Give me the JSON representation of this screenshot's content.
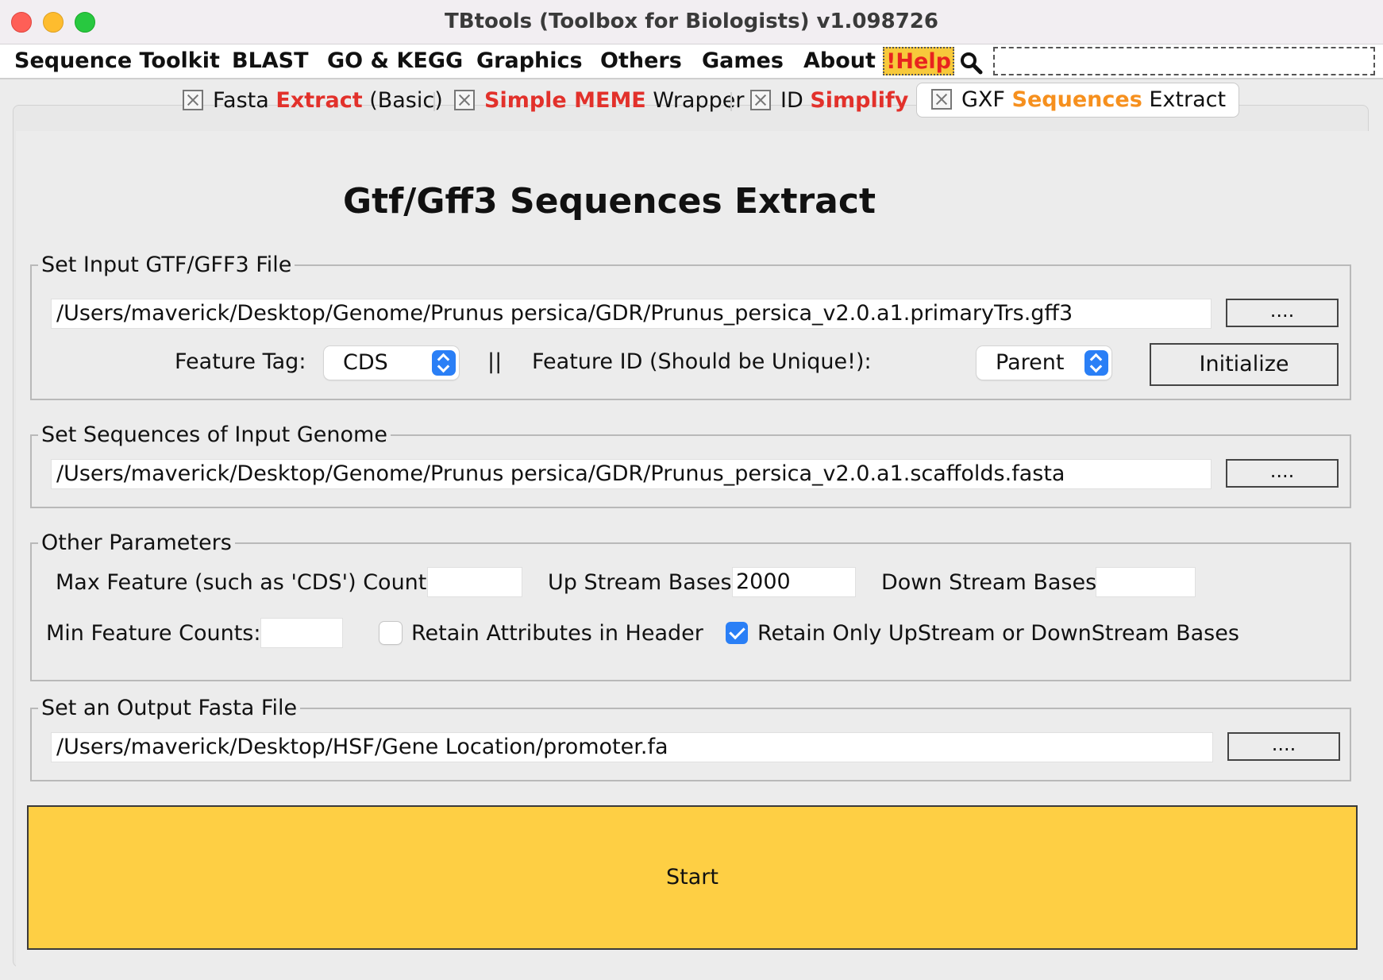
{
  "window": {
    "title": "TBtools (Toolbox for Biologists) v1.098726"
  },
  "menu": {
    "items": [
      "Sequence Toolkit",
      "BLAST",
      "GO & KEGG",
      "Graphics",
      "Others",
      "Games",
      "About"
    ],
    "help": "!Help"
  },
  "tabs": [
    {
      "parts": [
        "Fasta ",
        "Extract",
        " (Basic)"
      ]
    },
    {
      "parts": [
        "Simple MEME",
        " Wrapper"
      ]
    },
    {
      "parts": [
        "ID ",
        "Simplify"
      ]
    },
    {
      "parts": [
        "GXF ",
        "Sequences",
        " Extract"
      ]
    }
  ],
  "heading": "Gtf/Gff3 Sequences Extract",
  "input_gff": {
    "legend": "Set Input GTF/GFF3 File",
    "path": "/Users/maverick/Desktop/Genome/Prunus persica/GDR/Prunus_persica_v2.0.a1.primaryTrs.gff3",
    "browse": "....",
    "feature_tag_label": "Feature Tag:",
    "feature_tag_value": "CDS",
    "separator": "||",
    "feature_id_label": "Feature ID (Should be Unique!):",
    "feature_id_value": "Parent",
    "initialize": "Initialize"
  },
  "genome": {
    "legend": "Set Sequences of Input Genome",
    "path": "/Users/maverick/Desktop/Genome/Prunus persica/GDR/Prunus_persica_v2.0.a1.scaffolds.fasta",
    "browse": "...."
  },
  "params": {
    "legend": "Other Parameters",
    "max_feature_label": "Max Feature (such as 'CDS') Counts:",
    "max_feature_value": "",
    "upstream_label": "Up Stream Bases:",
    "upstream_value": "2000",
    "downstream_label": "Down Stream Bases:",
    "downstream_value": "",
    "min_feature_label": "Min Feature Counts:",
    "min_feature_value": "",
    "retain_attr_label": "Retain Attributes in Header",
    "retain_attr_checked": false,
    "retain_only_label": "Retain Only UpStream or DownStream Bases",
    "retain_only_checked": true
  },
  "output": {
    "legend": "Set an Output Fasta File",
    "path": "/Users/maverick/Desktop/HSF/Gene Location/promoter.fa",
    "browse": "...."
  },
  "start": "Start",
  "colors": {
    "help_bg": "#f7c93b",
    "help_text": "#e8231f",
    "accent_red": "#e2312b",
    "accent_orange": "#f6901e",
    "start_bg": "#fecf44",
    "check_blue": "#2a7ff6"
  }
}
